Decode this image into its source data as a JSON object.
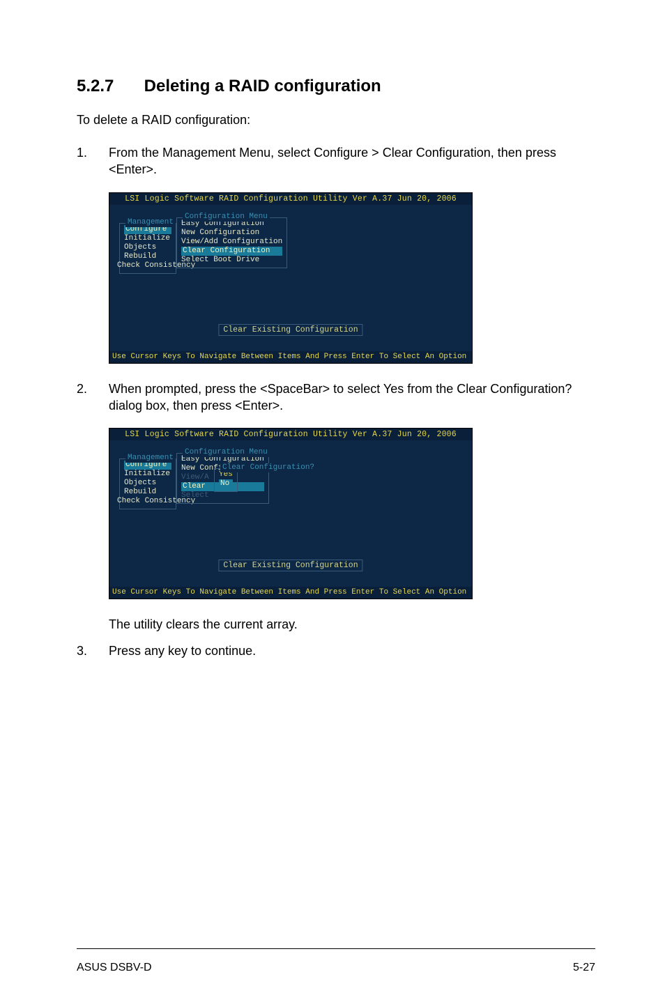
{
  "section": {
    "number": "5.2.7",
    "title": "Deleting a RAID configuration"
  },
  "intro": "To delete a RAID configuration:",
  "steps": {
    "s1": {
      "num": "1.",
      "text": "From the Management Menu, select Configure > Clear Configuration, then press <Enter>."
    },
    "s2": {
      "num": "2.",
      "text": "When prompted, press the <SpaceBar> to select Yes from the Clear Configuration? dialog box, then press <Enter>."
    },
    "s2b": {
      "text": "The utility clears the current array."
    },
    "s3": {
      "num": "3.",
      "text": "Press any key to continue."
    }
  },
  "bios1": {
    "title": "LSI Logic Software RAID Configuration Utility Ver A.37 Jun 20, 2006",
    "mgmt_title": "Management",
    "mgmt_items": [
      "Configure",
      "Initialize",
      "Objects",
      "Rebuild",
      "Check Consistency"
    ],
    "cfg_title": "Configuration Menu",
    "cfg_items": [
      "Easy Configuration",
      "New Configuration",
      "View/Add Configuration",
      "Clear Configuration",
      "Select Boot Drive"
    ],
    "status": "Clear Existing Configuration",
    "footer": "Use Cursor Keys To Navigate Between Items And Press Enter To Select An Option"
  },
  "bios2": {
    "title": "LSI Logic Software RAID Configuration Utility Ver A.37 Jun 20, 2006",
    "mgmt_title": "Management",
    "mgmt_items": [
      "Configure",
      "Initialize",
      "Objects",
      "Rebuild",
      "Check Consistency"
    ],
    "cfg_title": "Configuration Menu",
    "cfg_items_short": [
      "Easy Configuration",
      "New Configuration",
      "View/A",
      "Clear",
      "Select"
    ],
    "confirm_title": "Clear Configuration?",
    "confirm_items": [
      "Yes",
      "No"
    ],
    "status": "Clear Existing Configuration",
    "footer": "Use Cursor Keys To Navigate Between Items And Press Enter To Select An Option"
  },
  "footer": {
    "left": "ASUS DSBV-D",
    "right": "5-27"
  }
}
